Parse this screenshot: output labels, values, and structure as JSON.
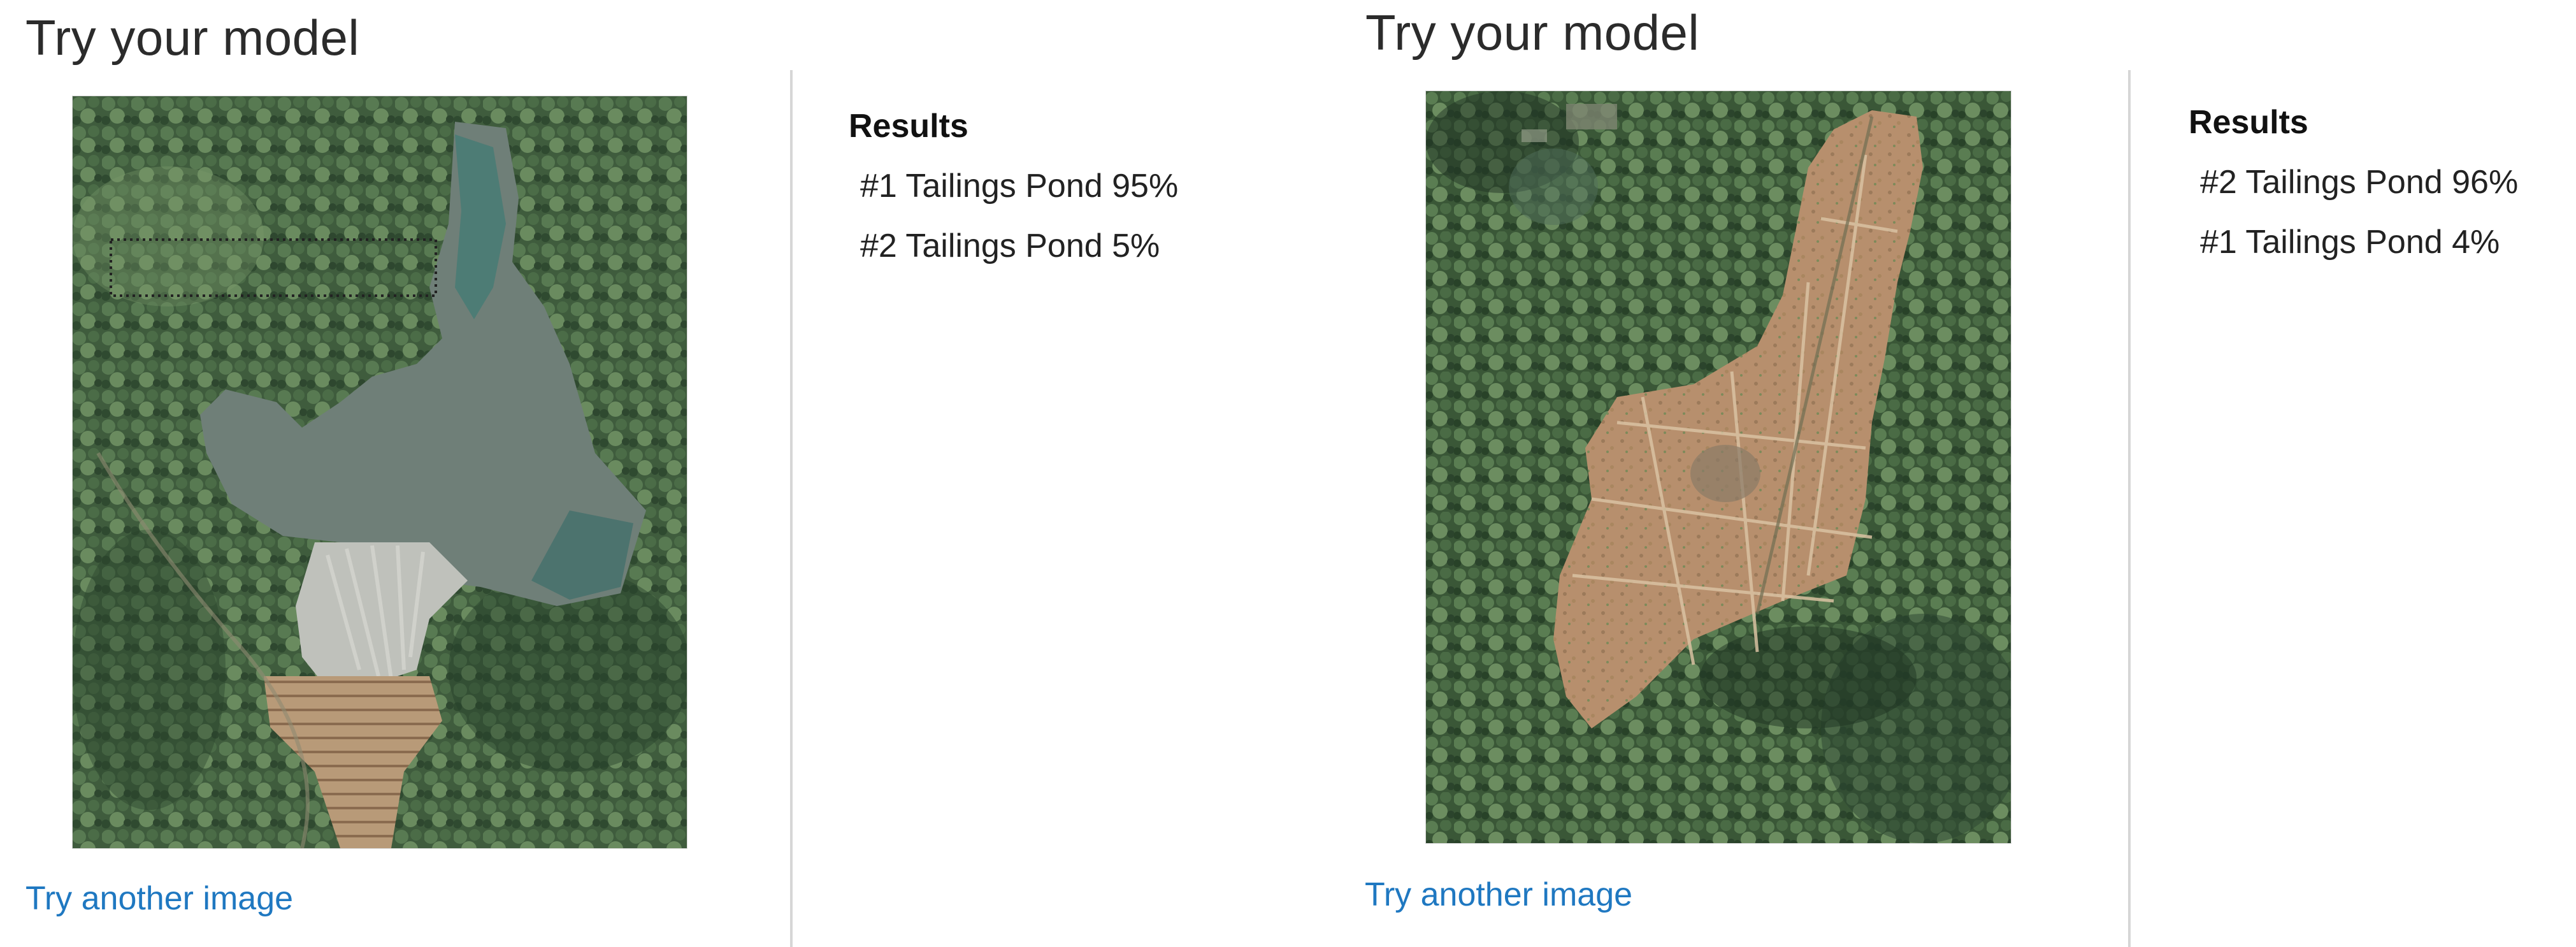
{
  "panels": [
    {
      "title": "Try your model",
      "link": "Try another image",
      "results_heading": "Results",
      "results": [
        {
          "label": "#1 Tailings Pond 95%"
        },
        {
          "label": "#2 Tailings Pond 5%"
        }
      ]
    },
    {
      "title": "Try your model",
      "link": "Try another image",
      "results_heading": "Results",
      "results": [
        {
          "label": "#2 Tailings Pond 96%"
        },
        {
          "label": "#1 Tailings Pond 4%"
        }
      ]
    }
  ],
  "colors": {
    "link": "#1f78c1",
    "divider": "#d6d6d6",
    "forest": "#3e5a3c",
    "water": "#6f7f7c",
    "tailings": "#b99072"
  }
}
